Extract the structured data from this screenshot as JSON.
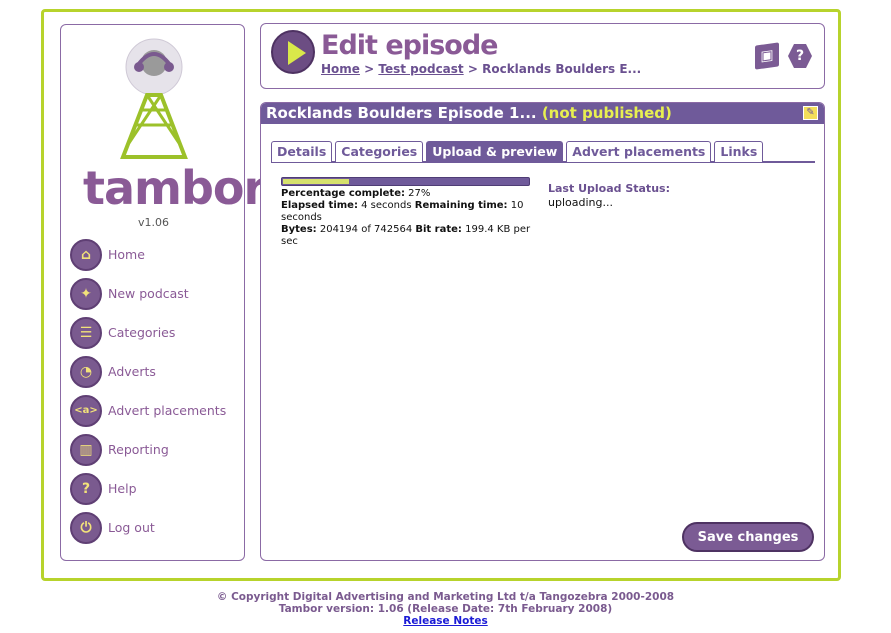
{
  "brand": {
    "name": "tambor",
    "version": "v1.06"
  },
  "nav": [
    {
      "label": "Home",
      "icon": "home-icon"
    },
    {
      "label": "New podcast",
      "icon": "new-podcast-icon"
    },
    {
      "label": "Categories",
      "icon": "categories-icon"
    },
    {
      "label": "Adverts",
      "icon": "adverts-icon"
    },
    {
      "label": "Advert placements",
      "icon": "advert-placements-icon"
    },
    {
      "label": "Reporting",
      "icon": "reporting-icon"
    },
    {
      "label": "Help",
      "icon": "help-icon"
    },
    {
      "label": "Log out",
      "icon": "logout-icon"
    }
  ],
  "header": {
    "title": "Edit episode",
    "breadcrumb": {
      "home": "Home",
      "sep1": " > ",
      "podcast": "Test podcast",
      "sep2": " > ",
      "current": "Rocklands Boulders E..."
    }
  },
  "panel": {
    "title": "Rocklands Boulders Episode 1...",
    "status": "(not published)",
    "tabs": [
      "Details",
      "Categories",
      "Upload & preview",
      "Advert placements",
      "Links"
    ],
    "active_tab": "Upload & preview"
  },
  "upload": {
    "progress_fraction": 0.27,
    "percent_label": "Percentage complete:",
    "percent_value": "27%",
    "elapsed_label": "Elapsed time:",
    "elapsed_value": "4 seconds",
    "remaining_label": "Remaining time:",
    "remaining_value": "10 seconds",
    "bytes_label": "Bytes:",
    "bytes_value": "204194 of 742564",
    "bitrate_label": "Bit rate:",
    "bitrate_value": "199.4 KB per sec",
    "last_status_label": "Last Upload Status:",
    "last_status_value": "uploading..."
  },
  "actions": {
    "save": "Save changes"
  },
  "footer": {
    "copyright": "© Copyright Digital Advertising and Marketing Ltd t/a Tangozebra 2000-2008",
    "version": "Tambor version: 1.06 (Release Date: 7th February 2008)",
    "release_notes": "Release Notes"
  },
  "colors": {
    "accent": "#6f5a9a",
    "frame": "#b7d32c",
    "brand": "#8a5a96",
    "highlight": "#e8f050"
  }
}
